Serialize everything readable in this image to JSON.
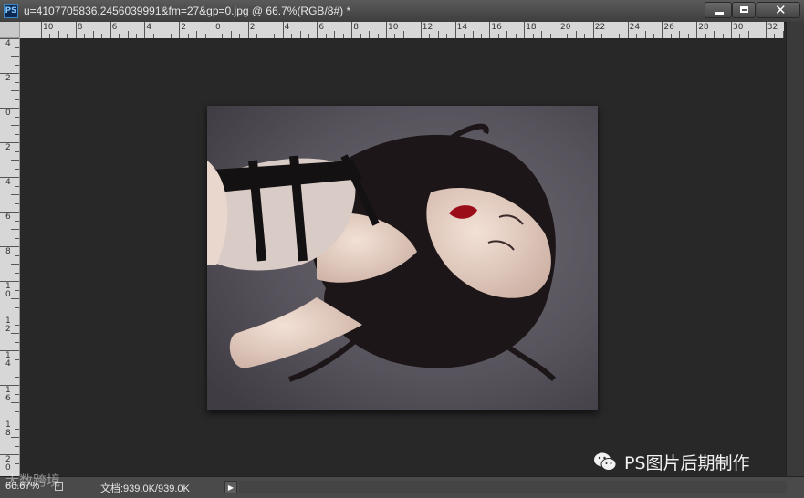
{
  "window": {
    "app_icon": "PS",
    "title": "u=4107705836,2456039991&fm=27&gp=0.jpg @ 66.7%(RGB/8#) *"
  },
  "window_controls": {
    "minimize_icon": "minimize-icon",
    "maximize_icon": "maximize-icon",
    "close_icon": "close-icon"
  },
  "ruler_top": {
    "labels": [
      "10",
      "8",
      "6",
      "4",
      "2",
      "0",
      "2",
      "4",
      "6",
      "8",
      "10",
      "12",
      "14",
      "16",
      "18",
      "20",
      "22",
      "24",
      "26",
      "28",
      "30",
      "32"
    ]
  },
  "ruler_left": {
    "labels": [
      "4",
      "2",
      "0",
      "2",
      "4",
      "6",
      "8",
      "1\n0",
      "1\n2",
      "1\n4",
      "1\n6",
      "1\n8",
      "2\n0"
    ]
  },
  "status": {
    "zoom": "66.67%",
    "doc_info": "文档:939.0K/939.0K"
  },
  "watermark": {
    "text": "PS图片后期制作",
    "overlay_text": "大数跨境"
  },
  "colors": {
    "background": "#282828",
    "canvas_bg": "#2b2b2b",
    "accent": "#3c87c8"
  }
}
